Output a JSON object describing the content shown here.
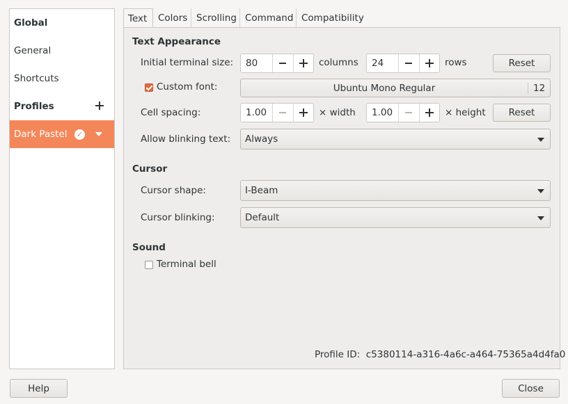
{
  "sidebar": {
    "global_label": "Global",
    "general_label": "General",
    "shortcuts_label": "Shortcuts",
    "profiles_label": "Profiles",
    "add_icon": "plus-icon",
    "selected_profile": "Dark Pastel",
    "selected_color": "#f4875a"
  },
  "tabs": [
    "Text",
    "Colors",
    "Scrolling",
    "Command",
    "Compatibility"
  ],
  "text_appearance": {
    "title": "Text Appearance",
    "initial_size_label": "Initial terminal size:",
    "columns_value": "80",
    "columns_label": "columns",
    "rows_value": "24",
    "rows_label": "rows",
    "reset_label": "Reset",
    "custom_font_label": "Custom font:",
    "custom_font_checked": true,
    "font_name": "Ubuntu Mono Regular",
    "font_size": "12",
    "cell_spacing_label": "Cell spacing:",
    "width_value": "1.00",
    "width_label": "× width",
    "height_value": "1.00",
    "height_label": "× height",
    "reset2_label": "Reset",
    "blinking_text_label": "Allow blinking text:",
    "blinking_text_value": "Always"
  },
  "cursor": {
    "title": "Cursor",
    "shape_label": "Cursor shape:",
    "shape_value": "I-Beam",
    "blinking_label": "Cursor blinking:",
    "blinking_value": "Default"
  },
  "sound": {
    "title": "Sound",
    "bell_label": "Terminal bell",
    "bell_checked": false
  },
  "profile_id": "Profile ID:  c5380114-a316-4a6c-a464-75365a4d4fa0",
  "footer": {
    "help_label": "Help",
    "close_label": "Close"
  }
}
